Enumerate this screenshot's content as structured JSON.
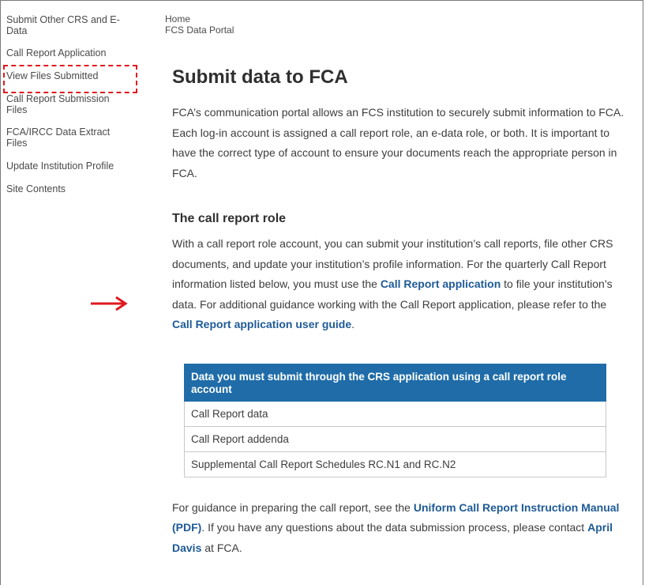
{
  "sidebar": {
    "items": [
      {
        "label": "Submit Other CRS and E-Data"
      },
      {
        "label": "Call Report Application"
      },
      {
        "label": "View Files Submitted"
      },
      {
        "label": "Call Report Submission Files"
      },
      {
        "label": "FCA/IRCC Data Extract Files"
      },
      {
        "label": "Update Institution Profile"
      },
      {
        "label": "Site Contents"
      }
    ]
  },
  "breadcrumb": {
    "home": "Home",
    "current": "FCS Data Portal"
  },
  "main": {
    "title": "Submit data to FCA",
    "intro": "FCA’s communication portal allows an FCS institution to securely submit information to FCA. Each log-in account is assigned a call report role, an e-data role, or both. It is important to have the correct type of account to ensure your documents reach the appropriate person in FCA.",
    "section_heading": "The call report role",
    "role_text_1": "With a call report role account, you can submit your institution’s call reports, file other CRS documents, and update your institution’s profile information. For the quarterly Call Report information listed below, you must use the ",
    "role_link_1": "Call Report application",
    "role_text_2": " to file your institution’s data.  For additional guidance working with the Call Report application, please refer to the ",
    "role_link_2": "Call Report application user guide",
    "role_text_3": ".",
    "table": {
      "header": "Data you must submit through the CRS application using a call report role account",
      "rows": [
        "Call Report data",
        "Call Report addenda",
        "Supplemental Call Report Schedules RC.N1 and RC.N2"
      ]
    },
    "guidance_text_1": "For guidance in preparing the call report, see the ",
    "guidance_link_1": "Uniform Call Report Instruction Manual (PDF)",
    "guidance_text_2": ". If you have any questions about the data submission process, please contact ",
    "guidance_link_2": "April Davis",
    "guidance_text_3": " at FCA."
  },
  "annotations": {
    "highlight_color": "#e0191e",
    "arrow_icon": "right-arrow-icon"
  },
  "colors": {
    "table_header_bg": "#1f6ca8",
    "link": "#1e5a96"
  }
}
